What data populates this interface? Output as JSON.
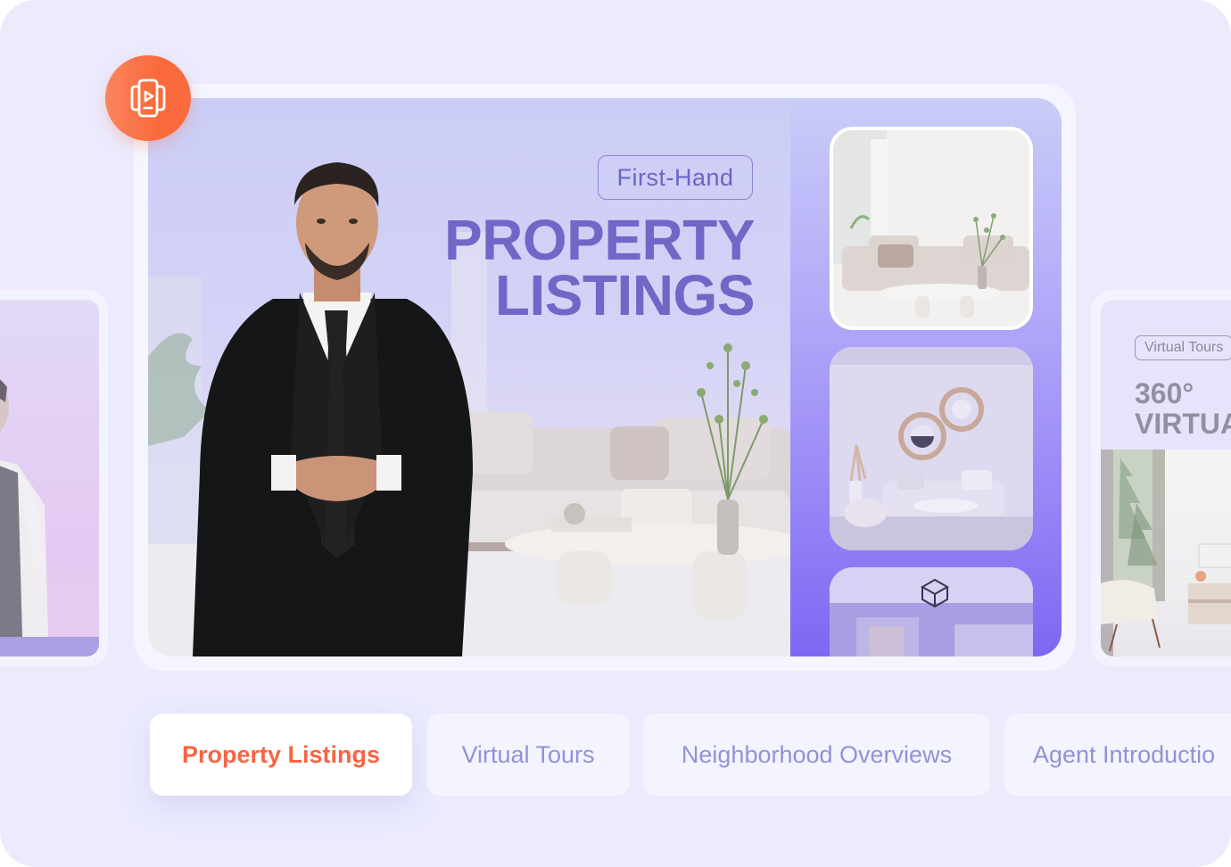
{
  "header": {
    "play_badge_icon": "video-carousel-icon"
  },
  "main_card": {
    "badge": "First-Hand",
    "headline_line1": "PROPERTY",
    "headline_line2": "LISTINGS",
    "presenter": "male-agent-avatar",
    "thumbnails": [
      {
        "name": "living-room-sofa-thumbnail"
      },
      {
        "name": "living-room-mirrors-thumbnail"
      },
      {
        "name": "ceiling-light-room-thumbnail"
      }
    ]
  },
  "side_left": {
    "presenter": "female-agent-avatar"
  },
  "side_right": {
    "badge": "Virtual Tours",
    "title_line1": "360°",
    "title_line2": "VIRTUA"
  },
  "tabs": [
    {
      "label": "Property Listings",
      "active": true
    },
    {
      "label": "Virtual Tours",
      "active": false
    },
    {
      "label": "Neighborhood Overviews",
      "active": false
    },
    {
      "label": "Agent Introductio",
      "active": false
    }
  ],
  "colors": {
    "accent_orange": "#fb6a3c",
    "headline_purple": "#7267c6",
    "tab_inactive_text": "#9590d6",
    "page_background": "#ebebfd"
  }
}
